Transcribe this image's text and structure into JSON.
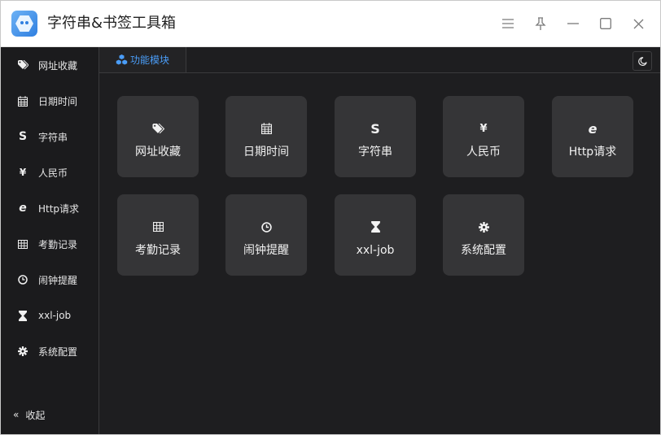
{
  "window": {
    "title": "字符串&书签工具箱",
    "icons": {
      "logo": "app-logo-icon",
      "menu": "menu-icon",
      "pin": "pin-icon",
      "minimize": "minimize-icon",
      "maximize": "maximize-icon",
      "close": "close-icon"
    }
  },
  "sidebar": {
    "items": [
      {
        "label": "网址收藏",
        "icon": "tags-icon"
      },
      {
        "label": "日期时间",
        "icon": "calendar-icon"
      },
      {
        "label": "字符串",
        "icon": "strikethrough-s-icon"
      },
      {
        "label": "人民币",
        "icon": "yen-icon"
      },
      {
        "label": "Http请求",
        "icon": "ie-icon"
      },
      {
        "label": "考勤记录",
        "icon": "table-icon"
      },
      {
        "label": "闹钟提醒",
        "icon": "clock-icon"
      },
      {
        "label": "xxl-job",
        "icon": "hourglass-icon"
      },
      {
        "label": "系统配置",
        "icon": "gear-icon"
      }
    ],
    "collapse_label": "收起"
  },
  "tabs": [
    {
      "label": "功能模块",
      "icon": "cubes-icon",
      "active": true
    }
  ],
  "theme_toggle_icon": "moon-icon",
  "modules": [
    {
      "label": "网址收藏",
      "icon": "tags-icon"
    },
    {
      "label": "日期时间",
      "icon": "calendar-icon"
    },
    {
      "label": "字符串",
      "icon": "strikethrough-s-icon"
    },
    {
      "label": "人民币",
      "icon": "yen-icon"
    },
    {
      "label": "Http请求",
      "icon": "ie-icon"
    },
    {
      "label": "考勤记录",
      "icon": "table-icon"
    },
    {
      "label": "闹钟提醒",
      "icon": "clock-icon"
    },
    {
      "label": "xxl-job",
      "icon": "hourglass-icon"
    },
    {
      "label": "系统配置",
      "icon": "gear-icon"
    }
  ],
  "colors": {
    "accent": "#4a9df8",
    "background": "#1e1e20",
    "sidebar": "#1b1b1d",
    "card": "#353537",
    "text": "#f2f2f2"
  }
}
